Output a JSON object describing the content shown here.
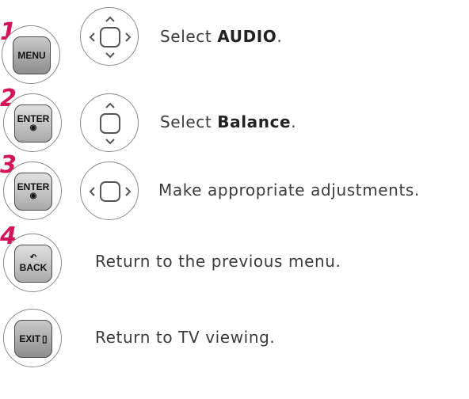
{
  "steps": [
    {
      "number": "1",
      "key": "MENU",
      "text_prefix": "Select ",
      "text_bold": "AUDIO",
      "text_suffix": "."
    },
    {
      "number": "2",
      "key": "ENTER",
      "key_sub": "◉",
      "text_prefix": "Select ",
      "text_bold": "Balance",
      "text_suffix": "."
    },
    {
      "number": "3",
      "key": "ENTER",
      "key_sub": "◉",
      "text": "Make appropriate adjustments."
    },
    {
      "number": "4",
      "key": "BACK",
      "key_sub_top": "↶",
      "text": "Return to the previous menu."
    },
    {
      "key": "EXIT",
      "key_icon": "▯",
      "text": "Return to TV viewing."
    }
  ],
  "colors": {
    "step_number": "#d4145a",
    "text": "#3b3b3b"
  }
}
